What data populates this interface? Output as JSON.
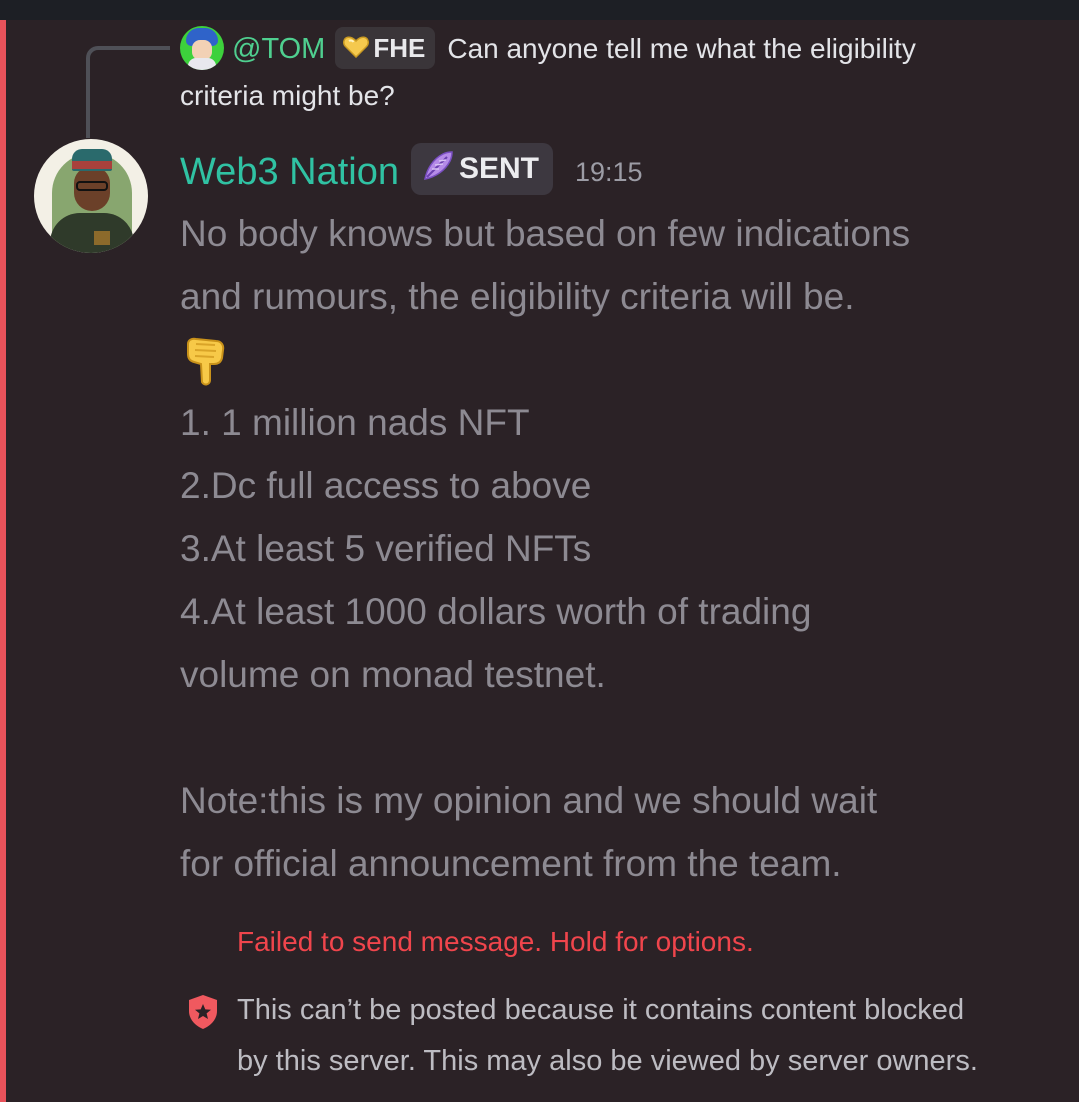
{
  "reply": {
    "username": "@TOM",
    "tag": "FHE",
    "text_line1": "Can anyone tell me what the eligibility",
    "text_line2": "criteria might be?"
  },
  "message": {
    "author": "Web3 Nation",
    "tag": "SENT",
    "timestamp": "19:15",
    "lines": [
      "No body knows but based on few indications",
      "and rumours, the eligibility criteria will be.",
      "👇",
      "1.  1 million nads NFT",
      "2.Dc full access to above",
      "3.At least 5 verified NFTs",
      "4.At least 1000 dollars worth of trading",
      "volume on monad testnet.",
      "",
      "Note:this is my opinion and we should wait",
      "for official announcement from the team."
    ]
  },
  "status": {
    "failed": "Failed to send message. Hold for options.",
    "blocked_line1": "This can’t be posted because it contains content blocked",
    "blocked_line2": "by this server. This may also be viewed by server owners."
  },
  "colors": {
    "background": "#2b2226",
    "rail": "#e8525a",
    "author": "#30c2a3",
    "reply_author": "#4fcf8f",
    "error": "#f0454c"
  },
  "icons": {
    "reply_avatar": "user-avatar-icon",
    "role_tag_reply": "yellow-heart-icon",
    "role_tag_author": "purple-feather-icon",
    "pointing": "backhand-index-pointing-down-icon",
    "blocked": "shield-star-icon"
  }
}
